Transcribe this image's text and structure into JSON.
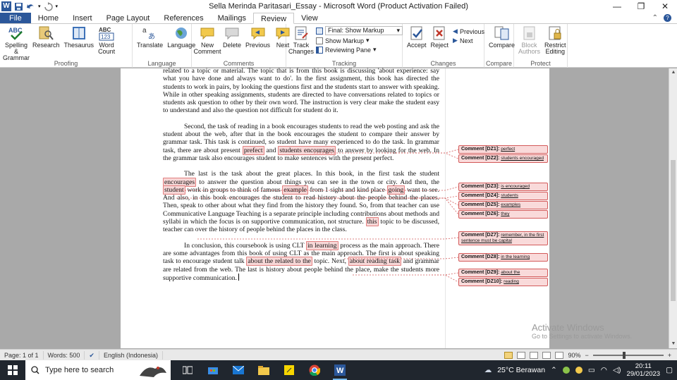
{
  "window": {
    "title": "Sella Merinda Paritasari_Essay  -  Microsoft Word (Product Activation Failed)",
    "min": "—",
    "restore": "❐",
    "close": "✕"
  },
  "tabs": [
    "File",
    "Home",
    "Insert",
    "Page Layout",
    "References",
    "Mailings",
    "Review",
    "View"
  ],
  "active_tab": "Review",
  "ribbon": {
    "proofing": {
      "label": "Proofing",
      "spelling": "Spelling & Grammar",
      "research": "Research",
      "thesaurus": "Thesaurus",
      "wordcount": "Word Count"
    },
    "language": {
      "label": "Language",
      "translate": "Translate",
      "language": "Language"
    },
    "comments": {
      "label": "Comments",
      "new": "New Comment",
      "delete": "Delete",
      "previous": "Previous",
      "next": "Next"
    },
    "tracking": {
      "label": "Tracking",
      "track": "Track Changes",
      "markup_select": "Final: Show Markup",
      "show_markup": "Show Markup",
      "reviewing_pane": "Reviewing Pane"
    },
    "changes": {
      "label": "Changes",
      "accept": "Accept",
      "reject": "Reject",
      "previous": "Previous",
      "next": "Next"
    },
    "compare": {
      "label": "Compare",
      "compare": "Compare"
    },
    "protect": {
      "label": "Protect",
      "block": "Block Authors",
      "restrict": "Restrict Editing"
    }
  },
  "document": {
    "p1": "related to a topic or material. The topic that is from this book is discussing 'about experience: say what you have done and always want to do'. In the first assignment, this book has directed the students to work in pairs, by looking the questions first and the students start to answer with speaking. While in other speaking assignments, students are directed to have conversations related to topics or students ask question to other by their own word. The instruction is very clear make the student easy to understand and also the question not difficult for student do it.",
    "p2a": "Second, the task of reading in a book encourages students to read the web posting and ask the student about the web, after that in the book encourages the student to compare their answer by grammar task. This task is continued, so student have many experienced to do the task. In grammar task, there are about present ",
    "p2_hl1": "prefect",
    "p2b": " and ",
    "p2_hl2": "students encourages",
    "p2c": " to answer by looking for the web. In the grammar task also encourages student to make sentences with the present perfect.",
    "p3a": "The last is the task about the great places. In this book, in the first task the student ",
    "p3_hl1": "encourages",
    "p3b": " to answer the question about things you can see in the town or city. And then, the ",
    "p3_hl2": "student",
    "p3c": " work in groups to think of famous ",
    "p3_hl3": "example",
    "p3d": " from 1 sight and kind place ",
    "p3_hl4": "going",
    "p3e": " want to see. And also, in this book encourages the student to read history about the people behind the places. Then, speak to other about what they find from the history they found. So, from that teacher can use Communicative Language Teaching is a separate principle including contributions about methods and syllabi in which the focus is on supportive communication, not structure. ",
    "p3_hl5": "this",
    "p3f": " topic to be discussed, teacher can over the history of people behind the places in the class.",
    "p4a": "In conclusion, this coursebook is using CLT ",
    "p4_hl1": "in learning",
    "p4b": " process as the main approach. There are some advantages from this book of using CLT as the main approach. The first is about speaking task to encourage student talk ",
    "p4_hl2": "about the related to the",
    "p4c": " topic. Next, ",
    "p4_hl3": "about reading task",
    "p4d": " and grammar are related from the web. The last is history about people behind the place, make the students more supportive communication."
  },
  "comments": [
    {
      "head": "Comment [DZ1]:",
      "body": "perfect"
    },
    {
      "head": "Comment [DZ2]:",
      "body": "students encouraged"
    },
    {
      "head": "Comment [DZ3]:",
      "body": "is encouraged"
    },
    {
      "head": "Comment [DZ4]:",
      "body": "students"
    },
    {
      "head": "Comment [DZ5]:",
      "body": "examples"
    },
    {
      "head": "Comment [DZ6]:",
      "body": "they"
    },
    {
      "head": "Comment [DZ7]:",
      "body": "remember, in the first sentence must be capital"
    },
    {
      "head": "Comment [DZ8]:",
      "body": "in the learning"
    },
    {
      "head": "Comment [DZ9]:",
      "body": "about the"
    },
    {
      "head": "Comment [DZ10]:",
      "body": "reading"
    }
  ],
  "watermark": {
    "line1": "Activate Windows",
    "line2": "Go to Settings to activate Windows."
  },
  "status": {
    "page": "Page: 1 of 1",
    "words": "Words: 500",
    "language": "English (Indonesia)",
    "zoom": "90%",
    "zoom_minus": "−",
    "zoom_plus": "+"
  },
  "taskbar": {
    "search_placeholder": "Type here to search",
    "weather": "25°C  Berawan",
    "time": "20:11",
    "date": "29/01/2023"
  },
  "colors": {
    "word_blue": "#2b579a",
    "comment_fill": "#f9dada",
    "comment_border": "#d35a5a"
  }
}
